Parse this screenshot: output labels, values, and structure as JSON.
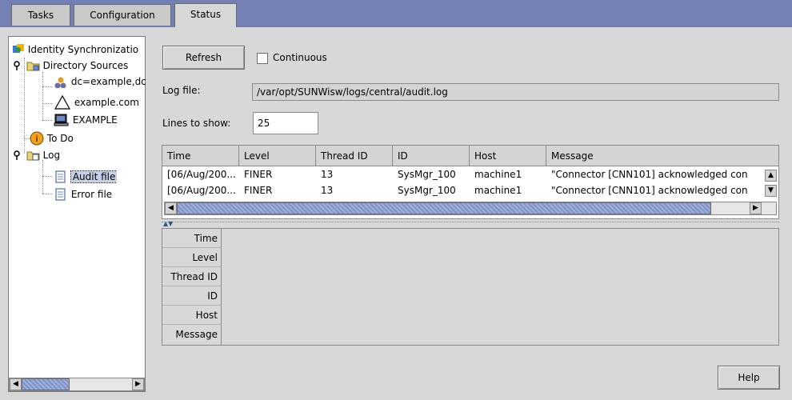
{
  "tabs": [
    {
      "label": "Tasks"
    },
    {
      "label": "Configuration"
    },
    {
      "label": "Status"
    }
  ],
  "tree": {
    "root": "Identity Synchronizatio",
    "directory_sources": "Directory Sources",
    "ds_items": [
      "dc=example,dc",
      "example.com",
      "EXAMPLE"
    ],
    "todo": "To Do",
    "log": "Log",
    "log_items": [
      "Audit file",
      "Error file"
    ]
  },
  "controls": {
    "refresh_label": "Refresh",
    "continuous_label": "Continuous",
    "continuous_checked": false,
    "logfile_label": "Log file:",
    "logfile_value": "/var/opt/SUNWisw/logs/central/audit.log",
    "lines_label": "Lines to show:",
    "lines_value": "25",
    "help_label": "Help"
  },
  "log_table": {
    "columns": [
      "Time",
      "Level",
      "Thread ID",
      "ID",
      "Host",
      "Message"
    ],
    "rows": [
      [
        "[06/Aug/200...",
        "FINER",
        "13",
        "SysMgr_100",
        "machine1",
        "\"Connector [CNN101] acknowledged con"
      ],
      [
        "[06/Aug/200...",
        "FINER",
        "13",
        "SysMgr_100",
        "machine1",
        "\"Connector [CNN101] acknowledged con"
      ]
    ]
  },
  "detail_fields": [
    "Time",
    "Level",
    "Thread ID",
    "ID",
    "Host",
    "Message"
  ],
  "icons": {
    "root": "identity-sync-icon",
    "folder": "folder-icon",
    "ds_items": [
      "ldap-server-icon",
      "active-directory-icon",
      "nt-domain-icon"
    ],
    "todo": "info-icon",
    "file": "log-file-icon"
  },
  "colors": {
    "topbar": "#747fb4",
    "panel": "#d8d8d8",
    "selection": "#c4cfe8",
    "scroll_thumb": "#8b9dcf"
  }
}
